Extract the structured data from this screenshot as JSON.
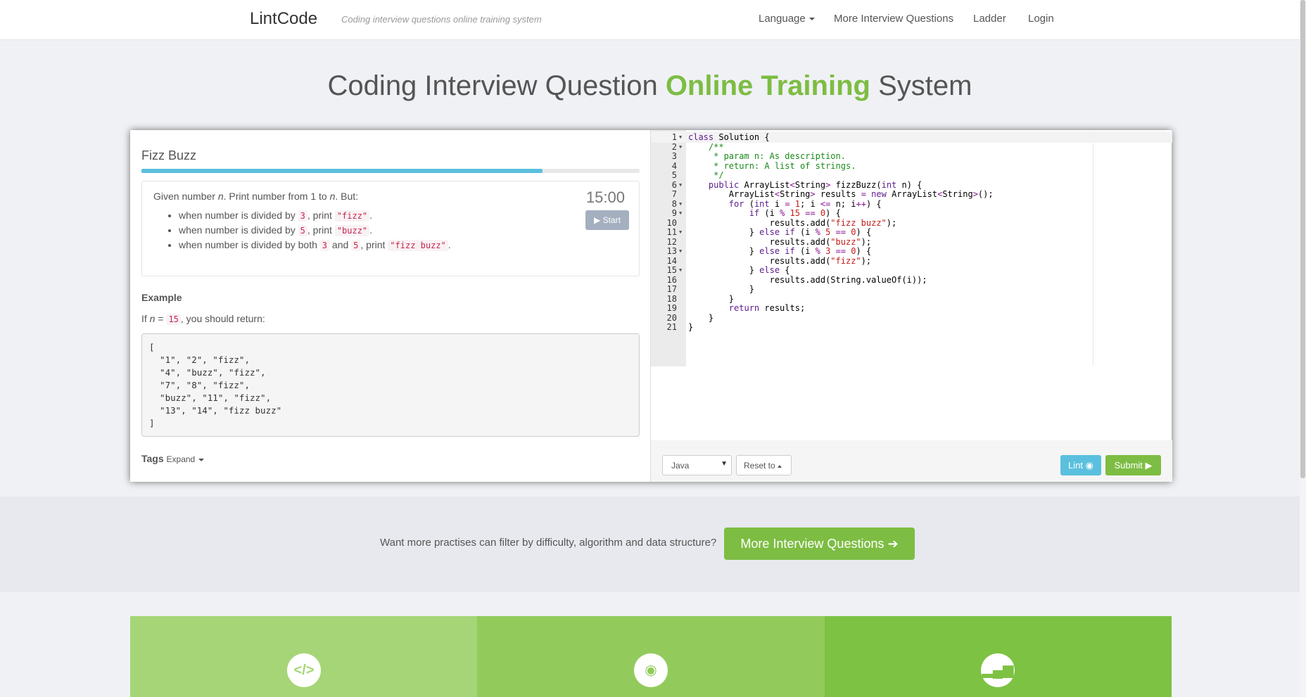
{
  "navbar": {
    "brand": "LintCode",
    "tagline": "Coding interview questions online training system",
    "language": "Language",
    "more_questions": "More Interview Questions",
    "ladder": "Ladder",
    "login": "Login"
  },
  "hero": {
    "title_before": "Coding Interview Question ",
    "title_accent": "Online Training",
    "title_after": " System"
  },
  "problem": {
    "title": "Fizz Buzz",
    "progress_fraction": 0.805,
    "timer": "15:00",
    "start_label": "Start",
    "intro": {
      "a": "Given number ",
      "n1": "n",
      "b": ". Print number from 1 to ",
      "n2": "n",
      "c": ". But:"
    },
    "rules": [
      {
        "text": "when number is divided by ",
        "num": "3",
        "mid": ", print ",
        "out": "\"fizz\"",
        "end": "."
      },
      {
        "text": "when number is divided by ",
        "num": "5",
        "mid": ", print ",
        "out": "\"buzz\"",
        "end": "."
      },
      {
        "text": "when number is divided by both ",
        "num": "3",
        "and": " and ",
        "num2": "5",
        "mid": ", print ",
        "out": "\"fizz buzz\"",
        "end": "."
      }
    ],
    "example_label": "Example",
    "example_text": {
      "a": "If ",
      "n": "n",
      "b": " = ",
      "val": "15",
      "c": ", you should return:"
    },
    "example_output": "[\n  \"1\", \"2\", \"fizz\",\n  \"4\", \"buzz\", \"fizz\",\n  \"7\", \"8\", \"fizz\",\n  \"buzz\", \"11\", \"fizz\",\n  \"13\", \"14\", \"fizz buzz\"\n]",
    "tags_label": "Tags",
    "tags_expand": "Expand"
  },
  "editor": {
    "lines": [
      "class Solution {",
      "    /**",
      "     * param n: As description.",
      "     * return: A list of strings.",
      "     */",
      "    public ArrayList<String> fizzBuzz(int n) {",
      "        ArrayList<String> results = new ArrayList<String>();",
      "        for (int i = 1; i <= n; i++) {",
      "            if (i % 15 == 0) {",
      "                results.add(\"fizz buzz\");",
      "            } else if (i % 5 == 0) {",
      "                results.add(\"buzz\");",
      "            } else if (i % 3 == 0) {",
      "                results.add(\"fizz\");",
      "            } else {",
      "                results.add(String.valueOf(i));",
      "            }",
      "        }",
      "        return results;",
      "    }",
      "}"
    ],
    "fold_lines": [
      1,
      2,
      6,
      8,
      9,
      11,
      13,
      15
    ],
    "language": "Java",
    "reset_label": "Reset to",
    "lint_label": "Lint",
    "submit_label": "Submit"
  },
  "cta": {
    "text": "Want more practises can filter by difficulty, algorithm and data structure?",
    "button": "More Interview Questions"
  },
  "features": {
    "icons": [
      "code-icon",
      "eye-icon",
      "signal-icon"
    ]
  },
  "colors": {
    "accent_green": "#7dbd43",
    "info_blue": "#5bc0de"
  }
}
